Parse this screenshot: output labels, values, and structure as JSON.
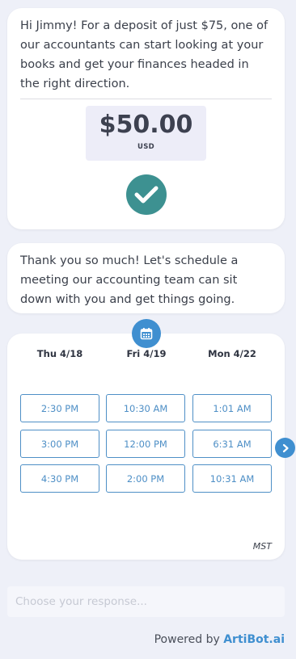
{
  "messages": {
    "deposit_text": "Hi Jimmy! For a deposit of just $75, one of our accountants can start looking at your books and get your finances headed in the right direction.",
    "thanks_text": "Thank you so much! Let's schedule a meeting our accounting team can sit down with you and get things going."
  },
  "payment": {
    "amount": "$50.00",
    "currency": "USD",
    "status_icon": "check-icon",
    "status_color": "#3d9191"
  },
  "schedule": {
    "icon": "calendar-icon",
    "days": [
      {
        "label": "Thu 4/18",
        "slots": [
          "2:30 PM",
          "3:00 PM",
          "4:30 PM"
        ]
      },
      {
        "label": "Fri 4/19",
        "slots": [
          "10:30 AM",
          "12:00 PM",
          "2:00 PM"
        ]
      },
      {
        "label": "Mon 4/22",
        "slots": [
          "1:01 AM",
          "6:31 AM",
          "10:31 AM"
        ]
      }
    ],
    "timezone": "MST",
    "next_icon": "chevron-right-icon"
  },
  "input": {
    "placeholder": "Choose your response...",
    "value": ""
  },
  "footer": {
    "powered_prefix": "Powered by",
    "brand": "ArtiBot.ai",
    "brand_color": "#3f8fd0"
  }
}
